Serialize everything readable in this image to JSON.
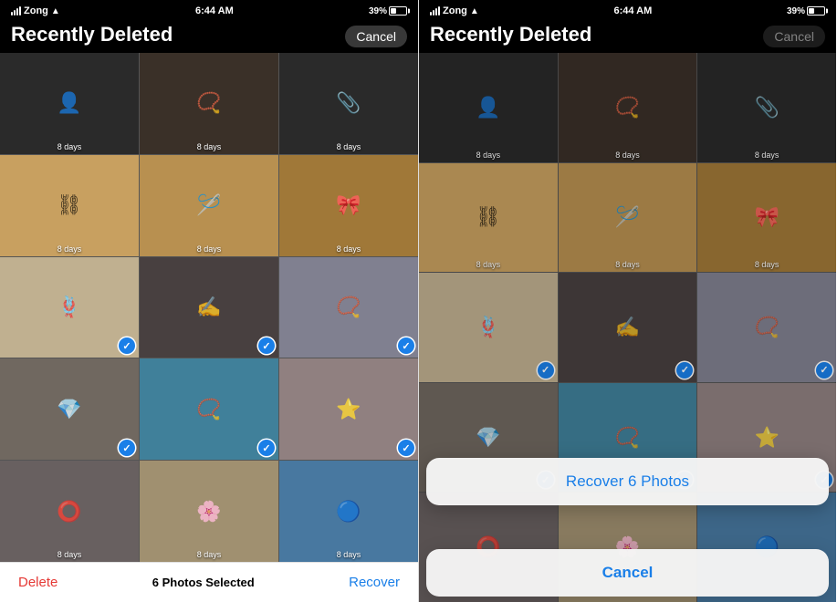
{
  "left_panel": {
    "status": {
      "carrier": "Zong",
      "time": "6:44 AM",
      "battery": "39%",
      "battery_pct": 39
    },
    "header": {
      "title": "Recently Deleted",
      "cancel_label": "Cancel"
    },
    "grid": {
      "rows": [
        [
          {
            "days": "8 days",
            "color": "#1a1a1a",
            "icon": "🖤",
            "checked": false
          },
          {
            "days": "8 days",
            "color": "#3a3028",
            "icon": "📿",
            "checked": false
          },
          {
            "days": "8 days",
            "color": "#1c1c1c",
            "icon": "📎",
            "checked": false
          }
        ],
        [
          {
            "days": "8 days",
            "color": "#c8a060",
            "icon": "⛓",
            "checked": false
          },
          {
            "days": "8 days",
            "color": "#b89050",
            "icon": "🪡",
            "checked": false
          },
          {
            "days": "8 days",
            "color": "#a07838",
            "icon": "🎀",
            "checked": false
          }
        ],
        [
          {
            "days": "",
            "color": "#c0b090",
            "icon": "🪢",
            "checked": true
          },
          {
            "days": "",
            "color": "#504848",
            "icon": "✍",
            "checked": true
          },
          {
            "days": "",
            "color": "#808090",
            "icon": "📿",
            "checked": true
          }
        ],
        [
          {
            "days": "",
            "color": "#707068",
            "icon": "💎",
            "checked": true
          },
          {
            "days": "",
            "color": "#40809a",
            "icon": "📿",
            "checked": true
          },
          {
            "days": "",
            "color": "#908080",
            "icon": "⭐",
            "checked": true
          }
        ],
        [
          {
            "days": "8 days",
            "color": "#686060",
            "icon": "⭕",
            "checked": false
          },
          {
            "days": "8 days",
            "color": "#a09070",
            "icon": "🌸",
            "checked": false
          },
          {
            "days": "8 days",
            "color": "#4878a0",
            "icon": "🔵",
            "checked": false
          }
        ]
      ]
    },
    "toolbar": {
      "delete_label": "Delete",
      "selected_label": "6 Photos Selected",
      "recover_label": "Recover"
    }
  },
  "right_panel": {
    "status": {
      "carrier": "Zong",
      "time": "6:44 AM",
      "battery": "39%",
      "battery_pct": 39
    },
    "header": {
      "title": "Recently Deleted",
      "cancel_label": "Cancel"
    },
    "action_sheet": {
      "recover_label": "Recover 6 Photos",
      "cancel_label": "Cancel"
    }
  }
}
